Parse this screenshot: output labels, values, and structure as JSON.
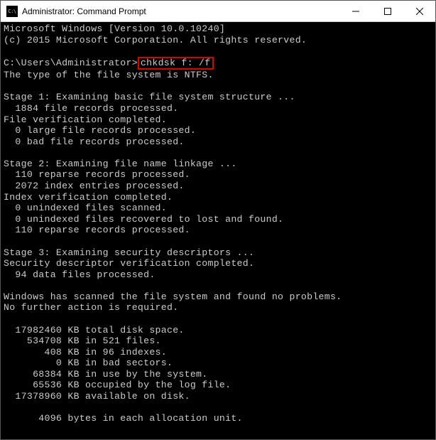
{
  "window": {
    "title": "Administrator: Command Prompt",
    "icon_label": "C:\\"
  },
  "terminal": {
    "header_line1": "Microsoft Windows [Version 10.0.10240]",
    "header_line2": "(c) 2015 Microsoft Corporation. All rights reserved.",
    "prompt_prefix": "C:\\Users\\Administrator>",
    "command": "chkdsk f: /f",
    "fs_type": "The type of the file system is NTFS.",
    "stage1_title": "Stage 1: Examining basic file system structure ...",
    "stage1_records": "  1884 file records processed.",
    "stage1_done": "File verification completed.",
    "stage1_large": "  0 large file records processed.",
    "stage1_bad": "  0 bad file records processed.",
    "stage2_title": "Stage 2: Examining file name linkage ...",
    "stage2_reparse": "  110 reparse records processed.",
    "stage2_index": "  2072 index entries processed.",
    "stage2_done": "Index verification completed.",
    "stage2_unidx_scan": "  0 unindexed files scanned.",
    "stage2_unidx_rec": "  0 unindexed files recovered to lost and found.",
    "stage2_reparse2": "  110 reparse records processed.",
    "stage3_title": "Stage 3: Examining security descriptors ...",
    "stage3_done": "Security descriptor verification completed.",
    "stage3_data": "  94 data files processed.",
    "scan_result": "Windows has scanned the file system and found no problems.",
    "no_action": "No further action is required.",
    "disk_total": "  17982460 KB total disk space.",
    "disk_files": "    534708 KB in 521 files.",
    "disk_indexes": "       408 KB in 96 indexes.",
    "disk_bad": "         0 KB in bad sectors.",
    "disk_system": "     68384 KB in use by the system.",
    "disk_log": "     65536 KB occupied by the log file.",
    "disk_avail": "  17378960 KB available on disk.",
    "alloc_unit": "      4096 bytes in each allocation unit."
  }
}
